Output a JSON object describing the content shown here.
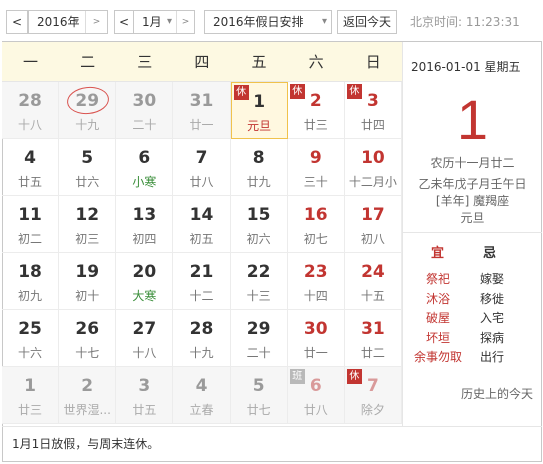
{
  "toolbar": {
    "year_label": "2016年",
    "month_label": "1月",
    "holiday_label": "2016年假日安排",
    "today_button": "返回今天",
    "prev_arrow": "<",
    "next_arrow": ">",
    "clock": "北京时间: 11:23:31"
  },
  "weekdays": [
    "一",
    "二",
    "三",
    "四",
    "五",
    "六",
    "日"
  ],
  "cells": [
    {
      "day": "28",
      "lunar": "十八",
      "other": true
    },
    {
      "day": "29",
      "lunar": "十九",
      "other": true,
      "circled": true
    },
    {
      "day": "30",
      "lunar": "二十",
      "other": true
    },
    {
      "day": "31",
      "lunar": "廿一",
      "other": true
    },
    {
      "day": "1",
      "lunar": "元旦",
      "festival": true,
      "today": true,
      "badge": "休"
    },
    {
      "day": "2",
      "lunar": "廿三",
      "weekend": true,
      "badge": "休"
    },
    {
      "day": "3",
      "lunar": "廿四",
      "weekend": true,
      "badge": "休"
    },
    {
      "day": "4",
      "lunar": "廿五"
    },
    {
      "day": "5",
      "lunar": "廿六"
    },
    {
      "day": "6",
      "lunar": "小寒",
      "term": true
    },
    {
      "day": "7",
      "lunar": "廿八"
    },
    {
      "day": "8",
      "lunar": "廿九"
    },
    {
      "day": "9",
      "lunar": "三十",
      "weekend": true
    },
    {
      "day": "10",
      "lunar": "十二月小",
      "weekend": true
    },
    {
      "day": "11",
      "lunar": "初二"
    },
    {
      "day": "12",
      "lunar": "初三"
    },
    {
      "day": "13",
      "lunar": "初四"
    },
    {
      "day": "14",
      "lunar": "初五"
    },
    {
      "day": "15",
      "lunar": "初六"
    },
    {
      "day": "16",
      "lunar": "初七",
      "weekend": true
    },
    {
      "day": "17",
      "lunar": "初八",
      "weekend": true
    },
    {
      "day": "18",
      "lunar": "初九"
    },
    {
      "day": "19",
      "lunar": "初十"
    },
    {
      "day": "20",
      "lunar": "大寒",
      "term": true
    },
    {
      "day": "21",
      "lunar": "十二"
    },
    {
      "day": "22",
      "lunar": "十三"
    },
    {
      "day": "23",
      "lunar": "十四",
      "weekend": true
    },
    {
      "day": "24",
      "lunar": "十五",
      "weekend": true
    },
    {
      "day": "25",
      "lunar": "十六"
    },
    {
      "day": "26",
      "lunar": "十七"
    },
    {
      "day": "27",
      "lunar": "十八"
    },
    {
      "day": "28",
      "lunar": "十九"
    },
    {
      "day": "29",
      "lunar": "二十"
    },
    {
      "day": "30",
      "lunar": "廿一",
      "weekend": true
    },
    {
      "day": "31",
      "lunar": "廿二",
      "weekend": true
    },
    {
      "day": "1",
      "lunar": "廿三",
      "other": true
    },
    {
      "day": "2",
      "lunar": "世界湿...",
      "other": true
    },
    {
      "day": "3",
      "lunar": "廿五",
      "other": true
    },
    {
      "day": "4",
      "lunar": "立春",
      "other": true,
      "term": true
    },
    {
      "day": "5",
      "lunar": "廿七",
      "other": true
    },
    {
      "day": "6",
      "lunar": "廿八",
      "other": true,
      "weekend": true,
      "badge": "班",
      "work": true
    },
    {
      "day": "7",
      "lunar": "除夕",
      "other": true,
      "weekend": true,
      "festival": true,
      "badge": "休"
    }
  ],
  "panel": {
    "date": "2016-01-01  星期五",
    "big_day": "1",
    "lunar_lines": [
      "农历十一月廿二",
      "乙未年戊子月壬午日",
      "[羊年] 魔羯座",
      "元旦"
    ],
    "yi_title": "宜",
    "ji_title": "忌",
    "yi": [
      "祭祀",
      "沐浴",
      "破屋",
      "坏垣",
      "余事勿取"
    ],
    "ji": [
      "嫁娶",
      "移徙",
      "入宅",
      "探病",
      "出行"
    ],
    "history": "历史上的今天"
  },
  "note": "1月1日放假，与周末连休。",
  "colors": {
    "red": "#c23531",
    "green": "#3a8e3a",
    "header_bg": "#fdf9e2"
  }
}
